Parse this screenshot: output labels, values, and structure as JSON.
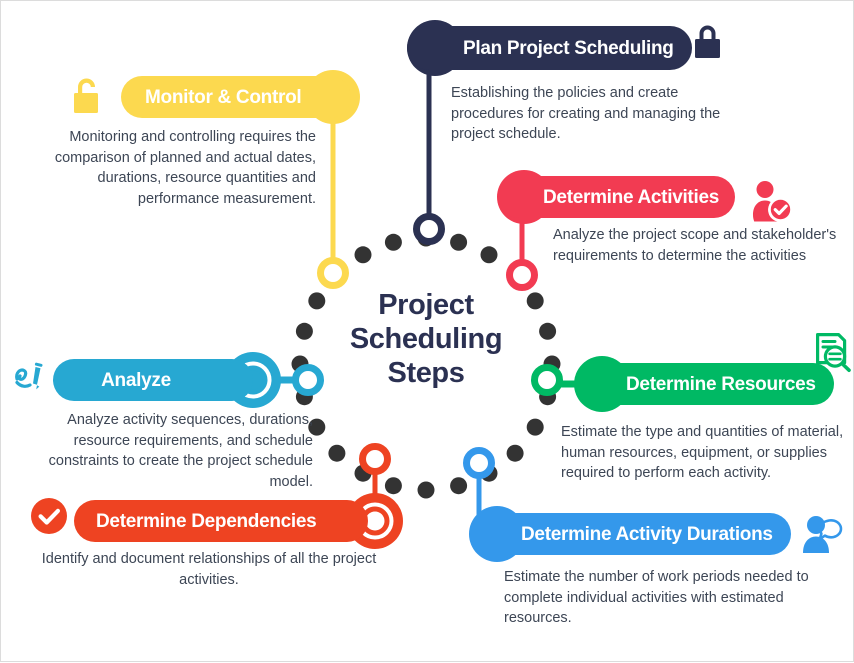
{
  "diagram": {
    "center_title_line1": "Project",
    "center_title_line2": "Scheduling",
    "center_title_line3": "Steps",
    "frame_border_color": "#dcdcdc",
    "dot_color": "#333333",
    "text_color": "#3d4655"
  },
  "steps": [
    {
      "id": "plan-project-scheduling",
      "label": "Plan Project Scheduling",
      "description": "Establishing the policies and create procedures for creating and managing the project schedule.",
      "color": "#2b3152",
      "icon": "lock-closed-icon",
      "node_color": "#2b3152"
    },
    {
      "id": "monitor-and-control",
      "label": "Monitor & Control",
      "description": "Monitoring and controlling requires the comparison of planned and actual dates, durations, resource quantities and performance measurement.",
      "color": "#fcd94f",
      "icon": "lock-open-icon",
      "node_color": "#fcd94f"
    },
    {
      "id": "determine-activities",
      "label": "Determine Activities",
      "description": "Analyze the project scope  and stakeholder's requirements to determine the activities",
      "color": "#f23b52",
      "icon": "user-check-icon",
      "node_color": "#f23b52"
    },
    {
      "id": "analyze",
      "label": "Analyze",
      "description": "Analyze activity sequences, durations, resource requirements, and schedule constraints to create the project schedule model.",
      "color": "#27a8d2",
      "icon": "signature-pen-icon",
      "node_color": "#27a8d2"
    },
    {
      "id": "determine-resources",
      "label": "Determine Resources",
      "description": "Estimate the type and quantities of material, human resources, equipment, or supplies required to perform each activity.",
      "color": "#00b964",
      "icon": "document-search-icon",
      "node_color": "#00b964"
    },
    {
      "id": "determine-dependencies",
      "label": "Determine Dependencies",
      "description": "Identify and document relationships of all the project activities.",
      "color": "#ee4322",
      "icon": "check-circle-icon",
      "node_color": "#ee4322"
    },
    {
      "id": "determine-activity-durations",
      "label": "Determine Activity Durations",
      "description": "Estimate the number of work periods needed to complete individual activities with estimated resources.",
      "color": "#3498eb",
      "icon": "user-speech-icon",
      "node_color": "#3498eb"
    }
  ]
}
